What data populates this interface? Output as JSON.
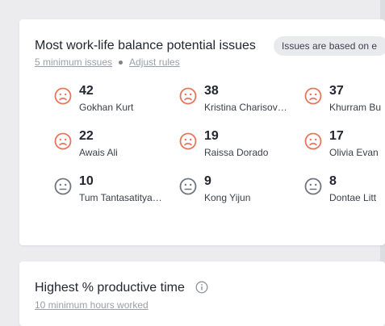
{
  "card1": {
    "title": "Most work-life balance potential issues",
    "badge": "Issues are based on e",
    "min_issues_link": "5 minimum issues",
    "adjust_rules_link": "Adjust rules",
    "people": [
      {
        "count": "42",
        "name": "Gokhan Kurt",
        "icon": "sad-face-icon"
      },
      {
        "count": "38",
        "name": "Kristina Charisov…",
        "icon": "sad-face-icon"
      },
      {
        "count": "37",
        "name": "Khurram Bu",
        "icon": "sad-face-icon"
      },
      {
        "count": "22",
        "name": "Awais Ali",
        "icon": "sad-face-icon"
      },
      {
        "count": "19",
        "name": "Raissa Dorado",
        "icon": "sad-face-icon"
      },
      {
        "count": "17",
        "name": "Olivia Evan",
        "icon": "sad-face-icon"
      },
      {
        "count": "10",
        "name": "Tum Tantasatitya…",
        "icon": "neutral-face-icon"
      },
      {
        "count": "9",
        "name": "Kong Yijun",
        "icon": "neutral-face-icon"
      },
      {
        "count": "8",
        "name": "Dontae Litt",
        "icon": "neutral-face-icon"
      }
    ]
  },
  "card2": {
    "title": "Highest % productive time",
    "min_hours_link": "10 minimum hours worked"
  },
  "colors": {
    "sad": "#e8745b",
    "neutral": "#70757f"
  }
}
